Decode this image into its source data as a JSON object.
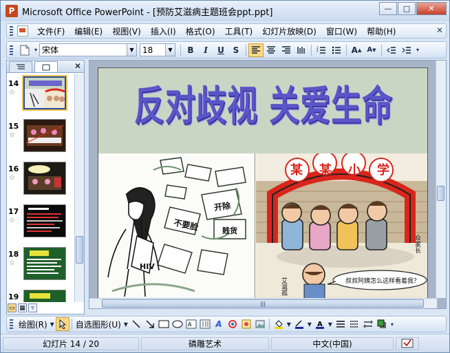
{
  "window": {
    "title": "Microsoft Office PowerPoint - [预防艾滋病主题班会ppt.ppt]",
    "app_icon": "powerpoint-icon",
    "controls": {
      "minimize": "—",
      "maximize": "□",
      "close": "✕"
    }
  },
  "menubar": {
    "items": [
      {
        "label": "文件(F)"
      },
      {
        "label": "编辑(E)"
      },
      {
        "label": "视图(V)"
      },
      {
        "label": "插入(I)"
      },
      {
        "label": "格式(O)"
      },
      {
        "label": "工具(T)"
      },
      {
        "label": "幻灯片放映(D)"
      },
      {
        "label": "窗口(W)"
      },
      {
        "label": "帮助(H)"
      }
    ],
    "end_glyph": "✕"
  },
  "format_toolbar": {
    "font_name": "宋体",
    "font_size": "18",
    "bold": "B",
    "italic": "I",
    "underline": "U",
    "shadow": "S"
  },
  "outline_pane": {
    "tabs": [
      "outline-tab",
      "slides-tab"
    ],
    "close_glyph": "✕",
    "thumbnails": [
      {
        "number": "14",
        "selected": true
      },
      {
        "number": "15",
        "selected": false
      },
      {
        "number": "16",
        "selected": false
      },
      {
        "number": "17",
        "selected": false
      },
      {
        "number": "18",
        "selected": false
      },
      {
        "number": "19",
        "selected": false
      }
    ],
    "star_glyph": "☆",
    "scroll_position": 0.72
  },
  "slide": {
    "title": "反对歧视 关爱生命",
    "left_picture_text": {
      "tag1": "不要脸",
      "tag2": "开除",
      "tag3": "贱货",
      "book": "HIV"
    },
    "right_picture_text": {
      "gate": "某某小学",
      "bubble": "叔叔阿姨怎么这样看着我？",
      "side1": "众家长",
      "side2": "艾滋孤"
    }
  },
  "drawing_toolbar": {
    "draw_label": "绘图(R)",
    "autoshapes_label": "自选图形(U)"
  },
  "statusbar": {
    "slide_position": "幻灯片 14 / 20",
    "design": "磷雕艺术",
    "language": "中文(中国)"
  },
  "colors": {
    "title": "#5a55c8",
    "slide_header_bg": "#c9d6c3",
    "selection": "#fbd888",
    "gate_red": "#d8261d"
  }
}
